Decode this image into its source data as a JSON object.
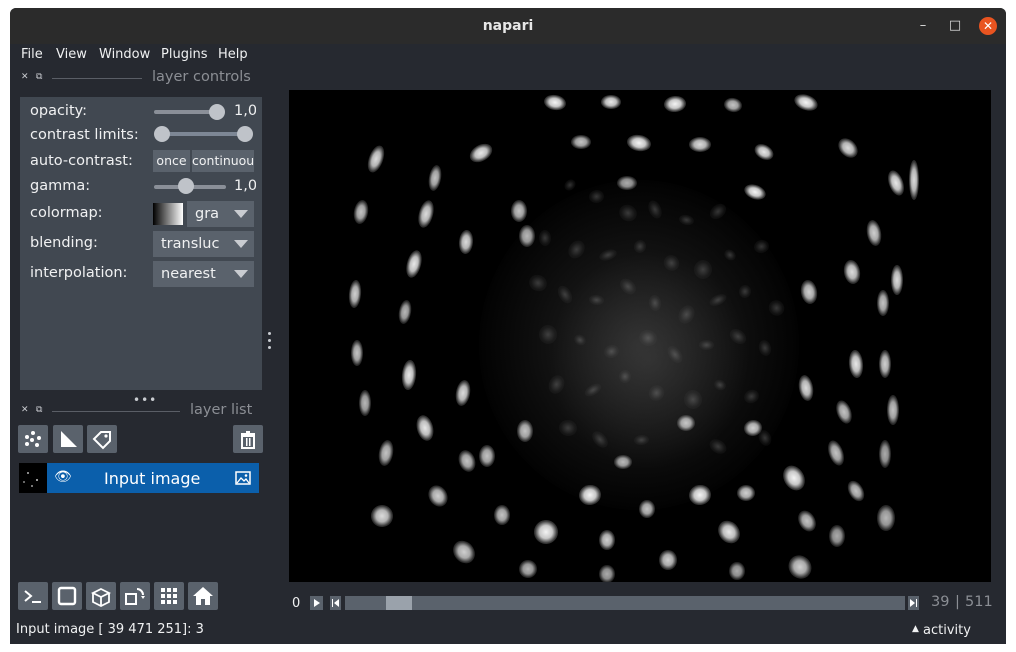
{
  "window": {
    "title": "napari",
    "minimize": "–",
    "maximize": "□",
    "close": "✕"
  },
  "menubar": [
    {
      "label": "File"
    },
    {
      "label": "View"
    },
    {
      "label": "Window"
    },
    {
      "label": "Plugins"
    },
    {
      "label": "Help"
    }
  ],
  "layer_controls": {
    "title": "layer controls",
    "opacity": {
      "label": "opacity:",
      "value": "1,0",
      "level": 1.0
    },
    "contrast_limits": {
      "label": "contrast limits:",
      "range": [
        0,
        1
      ]
    },
    "auto_contrast": {
      "label": "auto-contrast:",
      "once": "once",
      "continuous": "continuou"
    },
    "gamma": {
      "label": "gamma:",
      "value": "1,0",
      "level": 0.5
    },
    "colormap": {
      "label": "colormap:",
      "value": "gra"
    },
    "blending": {
      "label": "blending:",
      "value": "transluc"
    },
    "interpolation": {
      "label": "interpolation:",
      "value": "nearest"
    }
  },
  "layer_list": {
    "title": "layer list",
    "layers": [
      {
        "name": "Input image",
        "visible": true,
        "selected": true
      }
    ]
  },
  "colors": {
    "accent": "#0b5fab",
    "background": "#262930",
    "panel": "#414851",
    "close": "#e95420"
  },
  "dims": {
    "start": "0",
    "current": "39",
    "separator": "|",
    "max": "511",
    "slider_position": 0.076
  },
  "status": {
    "text": "Input image [ 39 471 251]: 3",
    "activity": "activity"
  }
}
